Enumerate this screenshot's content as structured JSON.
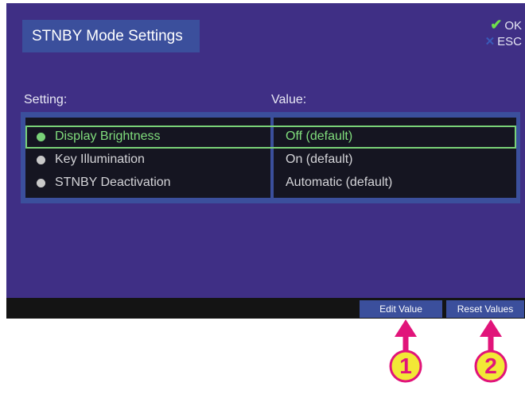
{
  "screen": {
    "title": "STNBY Mode Settings",
    "hints": {
      "ok_label": "OK",
      "esc_label": "ESC",
      "ok_icon": "checkmark-icon",
      "esc_icon": "x-icon"
    },
    "columns": {
      "setting": "Setting:",
      "value": "Value:"
    },
    "rows": [
      {
        "name": "Display Brightness",
        "value": "Off (default)",
        "selected": true
      },
      {
        "name": "Key Illumination",
        "value": "On (default)",
        "selected": false
      },
      {
        "name": "STNBY Deactivation",
        "value": "Automatic (default)",
        "selected": false
      }
    ],
    "softkeys": {
      "edit_label": "Edit Value",
      "reset_label": "Reset Values"
    }
  },
  "callouts": [
    {
      "number": "1",
      "target": "Edit Value"
    },
    {
      "number": "2",
      "target": "Reset Values"
    }
  ],
  "colors": {
    "background": "#3f2f85",
    "panel": "#3b4f9c",
    "selection": "#79d278",
    "callout_pink": "#e1147a",
    "callout_fill": "#f2e836"
  }
}
